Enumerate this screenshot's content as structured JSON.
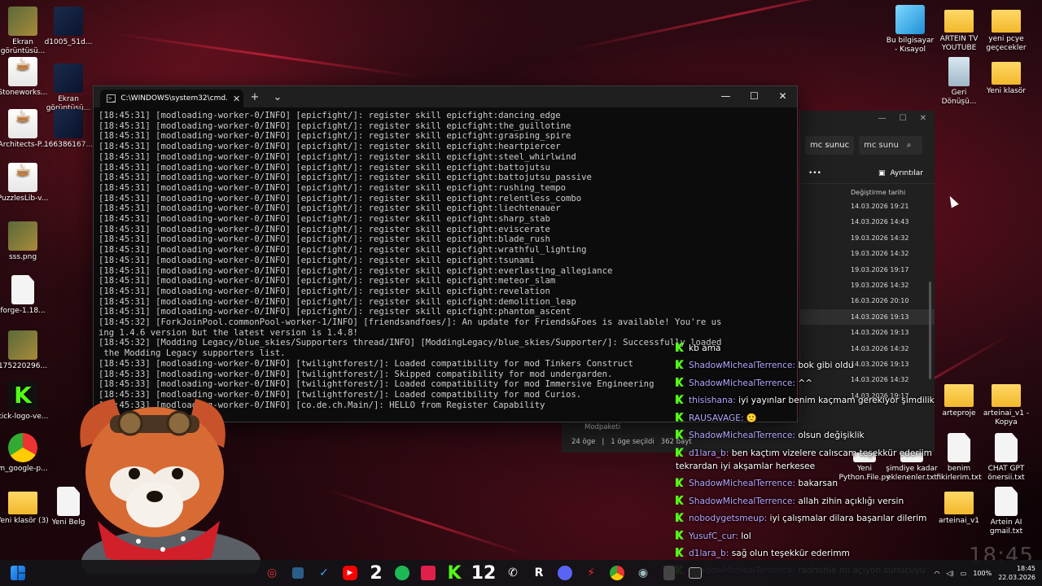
{
  "desktop_left": [
    {
      "label": "Ekran görüntüsü...",
      "icon": "screenshot-icon",
      "type": "thumb"
    },
    {
      "label": "d1005_51d...",
      "icon": "image-icon",
      "type": "dark"
    },
    {
      "label": "Stoneworks...",
      "icon": "java-icon",
      "type": "java"
    },
    {
      "label": "Ekran görüntüsü...",
      "icon": "screenshot-icon",
      "type": "dark"
    },
    {
      "label": "Architects-P...",
      "icon": "java-icon",
      "type": "java"
    },
    {
      "label": "166386167...",
      "icon": "image-icon",
      "type": "dark"
    },
    {
      "label": "PuzzlesLib-v...",
      "icon": "java-icon",
      "type": "java"
    },
    {
      "label": "sss.png",
      "icon": "image-icon",
      "type": "thumb"
    },
    {
      "label": "forge-1.18...",
      "icon": "file-icon",
      "type": "file"
    },
    {
      "label": "175220296...",
      "icon": "image-icon",
      "type": "thumb"
    },
    {
      "label": "kick-logo-ve...",
      "icon": "kick-icon",
      "type": "kick"
    },
    {
      "label": "m_google-p...",
      "icon": "image-icon",
      "type": "chrome"
    },
    {
      "label": "Yeni klasör (3)",
      "icon": "folder-icon",
      "type": "folder"
    },
    {
      "label": "Yeni Belg",
      "icon": "file-icon",
      "type": "file"
    }
  ],
  "desktop_right": [
    {
      "label": "Bu bilgisayar - Kısayol",
      "icon": "pc-icon",
      "type": "pc"
    },
    {
      "label": "ARTEIN TV YOUTUBE",
      "icon": "folder-icon",
      "type": "folder"
    },
    {
      "label": "yeni pcye geçecekler",
      "icon": "folder-icon",
      "type": "folder"
    },
    {
      "label": "Geri Dönüşü...",
      "icon": "recycle-bin-icon",
      "type": "bin"
    },
    {
      "label": "Yeni klasör",
      "icon": "folder-icon",
      "type": "folder"
    },
    {
      "label": "arteproje",
      "icon": "folder-icon",
      "type": "folder"
    },
    {
      "label": "arteinai_v1 - Kopya",
      "icon": "folder-icon",
      "type": "folder"
    },
    {
      "label": "Yeni Python.File.py",
      "icon": "file-icon",
      "type": "file"
    },
    {
      "label": "şimdiye kadar eklenenler.txt",
      "icon": "file-icon",
      "type": "file"
    },
    {
      "label": "benim fikirlerim.txt",
      "icon": "file-icon",
      "type": "file"
    },
    {
      "label": "CHAT GPT önersii.txt",
      "icon": "file-icon",
      "type": "file"
    },
    {
      "label": "arteinai_v1",
      "icon": "folder-icon",
      "type": "folder"
    },
    {
      "label": "Artein AI gmail.txt",
      "icon": "file-icon",
      "type": "file"
    }
  ],
  "cmd": {
    "tab_title": "C:\\WINDOWS\\system32\\cmd.",
    "new_tab": "+",
    "dropdown": "⌄",
    "lines": [
      "[18:45:31] [modloading-worker-0/INFO] [epicfight/]: register skill epicfight:dancing_edge",
      "[18:45:31] [modloading-worker-0/INFO] [epicfight/]: register skill epicfight:the_guillotine",
      "[18:45:31] [modloading-worker-0/INFO] [epicfight/]: register skill epicfight:grasping_spire",
      "[18:45:31] [modloading-worker-0/INFO] [epicfight/]: register skill epicfight:heartpiercer",
      "[18:45:31] [modloading-worker-0/INFO] [epicfight/]: register skill epicfight:steel_whirlwind",
      "[18:45:31] [modloading-worker-0/INFO] [epicfight/]: register skill epicfight:battojutsu",
      "[18:45:31] [modloading-worker-0/INFO] [epicfight/]: register skill epicfight:battojutsu_passive",
      "[18:45:31] [modloading-worker-0/INFO] [epicfight/]: register skill epicfight:rushing_tempo",
      "[18:45:31] [modloading-worker-0/INFO] [epicfight/]: register skill epicfight:relentless_combo",
      "[18:45:31] [modloading-worker-0/INFO] [epicfight/]: register skill epicfight:liechtenauer",
      "[18:45:31] [modloading-worker-0/INFO] [epicfight/]: register skill epicfight:sharp_stab",
      "[18:45:31] [modloading-worker-0/INFO] [epicfight/]: register skill epicfight:eviscerate",
      "[18:45:31] [modloading-worker-0/INFO] [epicfight/]: register skill epicfight:blade_rush",
      "[18:45:31] [modloading-worker-0/INFO] [epicfight/]: register skill epicfight:wrathful_lighting",
      "[18:45:31] [modloading-worker-0/INFO] [epicfight/]: register skill epicfight:tsunami",
      "[18:45:31] [modloading-worker-0/INFO] [epicfight/]: register skill epicfight:everlasting_allegiance",
      "[18:45:31] [modloading-worker-0/INFO] [epicfight/]: register skill epicfight:meteor_slam",
      "[18:45:31] [modloading-worker-0/INFO] [epicfight/]: register skill epicfight:revelation",
      "[18:45:31] [modloading-worker-0/INFO] [epicfight/]: register skill epicfight:demolition_leap",
      "[18:45:31] [modloading-worker-0/INFO] [epicfight/]: register skill epicfight:phantom_ascent",
      "[18:45:32] [ForkJoinPool.commonPool-worker-1/INFO] [friendsandfoes/]: An update for Friends&Foes is available! You're us",
      "ing 1.4.6 version but the latest version is 1.4.8!",
      "[18:45:32] [Modding Legacy/blue_skies/Supporters thread/INFO] [ModdingLegacy/blue_skies/Supporter/]: Successfully loaded",
      " the Modding Legacy supporters list.",
      "[18:45:33] [modloading-worker-0/INFO] [twilightforest/]: Loaded compatibility for mod Tinkers Construct",
      "[18:45:33] [modloading-worker-0/INFO] [twilightforest/]: Skipped compatibility for mod undergarden.",
      "[18:45:33] [modloading-worker-0/INFO] [twilightforest/]: Loaded compatibility for mod Immersive Engineering",
      "[18:45:33] [modloading-worker-0/INFO] [twilightforest/]: Loaded compatibility for mod Curios.",
      "[18:45:33] [modloading-worker-0/INFO] [co.de.ch.Main/]: HELLO from Register Capability"
    ]
  },
  "explorer": {
    "breadcrumb": "mc sunuc",
    "search_text": "mc sunu",
    "details_label": "Ayrıntılar",
    "column_header": "Değiştirme tarihi",
    "dates": [
      "14.03.2026 19:21",
      "14.03.2026 14:43",
      "19.03.2026 14:32",
      "19.03.2026 14:32",
      "19.03.2026 19:17",
      "19.03.2026 14:32",
      "16.03.2026 20:10",
      "14.03.2026 19:13",
      "14.03.2026 19:13",
      "14.03.2026 14:32",
      "14.03.2026 19:13",
      "14.03.2026 14:32",
      "14.03.2026 19:17"
    ],
    "status_count": "24 öge",
    "status_selected": "1 öge seçildi",
    "status_size": "362 bayt",
    "folder_label": "Modpaketi"
  },
  "chat": [
    {
      "user": "",
      "text": "kb ama"
    },
    {
      "user": "ShadowMichealTerrence",
      "text": "bok gibi oldu"
    },
    {
      "user": "ShadowMichealTerrence",
      "text": "^^"
    },
    {
      "user": "thisishana",
      "text": "iyi yayınlar benim kaçmam gerekiyor şimdilik"
    },
    {
      "user": "RAUSAVAGE",
      "text": "🙂"
    },
    {
      "user": "ShadowMichealTerrence",
      "text": "olsun değişiklik"
    },
    {
      "user": "d1lara_b",
      "text": "ben kaçtım vizelere calıscam teşekkür ederiim tekrardan iyi akşamlar herkesee"
    },
    {
      "user": "ShadowMichealTerrence",
      "text": "bakarsan"
    },
    {
      "user": "ShadowMichealTerrence",
      "text": "allah zihin açıklığı versin"
    },
    {
      "user": "nobodygetsmeup",
      "text": "iyi çalışmalar dilara başarılar dilerim"
    },
    {
      "user": "YusufC_cur",
      "text": "lol"
    },
    {
      "user": "d1lara_b",
      "text": "sağ olun teşekkür ederimm"
    },
    {
      "user": "ShadowMichealTerrence",
      "text": "radminle mi açıyon sunucuyu"
    }
  ],
  "taskbar": {
    "icons": [
      "windows-start-icon",
      "security-icon",
      "file-explorer-icon",
      "edge-icon",
      "youtube-icon",
      "spotify-icon",
      "tiktok-icon",
      "kick-icon",
      "whatsapp-icon",
      "r-app-icon",
      "discord-icon",
      "game-icon",
      "chrome-icon",
      "steam-icon",
      "calculator-icon",
      "terminal-icon"
    ],
    "badge_2": "2",
    "badge_12": "12",
    "battery": "100%",
    "time": "18:45",
    "date": "22.03.2026",
    "big_clock": "18:45"
  },
  "colors": {
    "kick_green": "#53fc18",
    "chat_user": "#b9a7ff",
    "console_text": "#cccccc",
    "console_bg": "#0c0c0c"
  }
}
